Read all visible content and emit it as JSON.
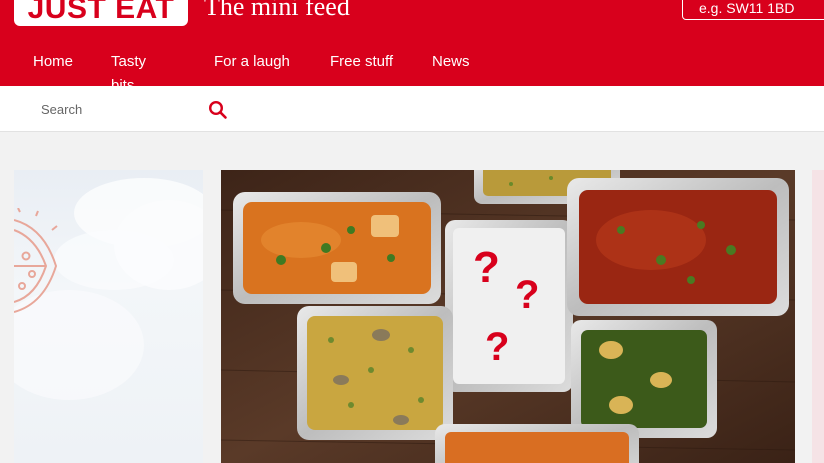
{
  "header": {
    "logo_text": "JUST EAT",
    "tagline": "The mini feed",
    "postcode_placeholder": "e.g. SW11 1BD"
  },
  "nav": {
    "items": [
      {
        "label": "Home"
      },
      {
        "label": "Tasty bits"
      },
      {
        "label": "For a laugh"
      },
      {
        "label": "Free stuff"
      },
      {
        "label": "News"
      }
    ]
  },
  "search": {
    "placeholder": "Search"
  },
  "colors": {
    "brand_red": "#d8001c",
    "white": "#ffffff",
    "background": "#f2f2f2"
  },
  "icons": {
    "search": "search-icon",
    "side_graphic": "pizza-icon"
  }
}
